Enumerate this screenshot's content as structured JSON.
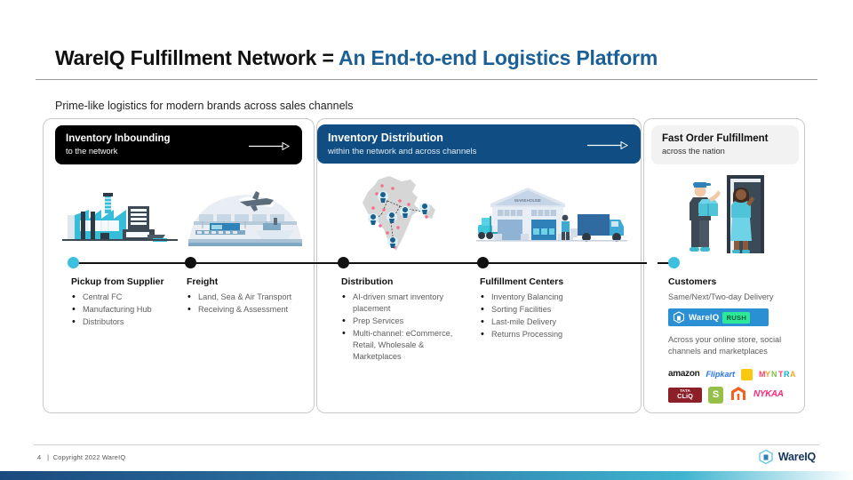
{
  "slide": {
    "title_main": "WareIQ Fulfillment Network = ",
    "title_accent": "An End-to-end Logistics Platform",
    "subtitle": "Prime-like logistics for modern brands across sales channels"
  },
  "panels": [
    {
      "title": "Inventory Inbounding",
      "subtitle": "to the network",
      "arrow": "arrow-right-icon"
    },
    {
      "title": "Inventory Distribution",
      "subtitle": "within the network and across channels",
      "arrow": "arrow-right-icon"
    },
    {
      "title": "Fast Order Fulfillment",
      "subtitle": "across the nation"
    }
  ],
  "columns": [
    {
      "heading": "Pickup from Supplier",
      "items": [
        "Central FC",
        "Manufacturing Hub",
        "Distributors"
      ]
    },
    {
      "heading": "Freight",
      "items": [
        "Land, Sea & Air Transport",
        "Receiving & Assessment"
      ]
    },
    {
      "heading": "Distribution",
      "items": [
        "AI-driven smart inventory placement",
        "Prep Services",
        "Multi-channel: eCommerce, Retail, Wholesale & Marketplaces"
      ]
    },
    {
      "heading": "Fulfillment Centers",
      "items": [
        "Inventory Balancing",
        "Sorting Facilities",
        "Last-mile Delivery",
        "Returns Processing"
      ]
    }
  ],
  "customers": {
    "heading": "Customers",
    "delivery_line": "Same/Next/Two-day Delivery",
    "badge_brand": "WareIQ",
    "badge_tag": "RUSH",
    "channels_line": "Across your online store, social channels and marketplaces",
    "marketplaces": [
      "amazon",
      "Flipkart",
      "MYNTRA",
      "TATA CLiQ",
      "Shopify",
      "Magento",
      "NYKAA"
    ]
  },
  "illustrations": {
    "factory": "factory-icon",
    "port": "port-air-freight-icon",
    "map": "india-map-icon",
    "warehouse": "warehouse-truck-icon",
    "delivery": "doorstep-delivery-icon",
    "warehouse_label": "WAREHOUSE"
  },
  "footer": {
    "page_number": "4",
    "separator": "|",
    "copyright": "Copyright 2022 WareIQ",
    "logo_text": "WareIQ"
  },
  "colors": {
    "accent_blue": "#1a5f96",
    "panel_blue": "#0f4d82",
    "cyan": "#3cc0dd",
    "rush_green": "#2ee89a"
  }
}
